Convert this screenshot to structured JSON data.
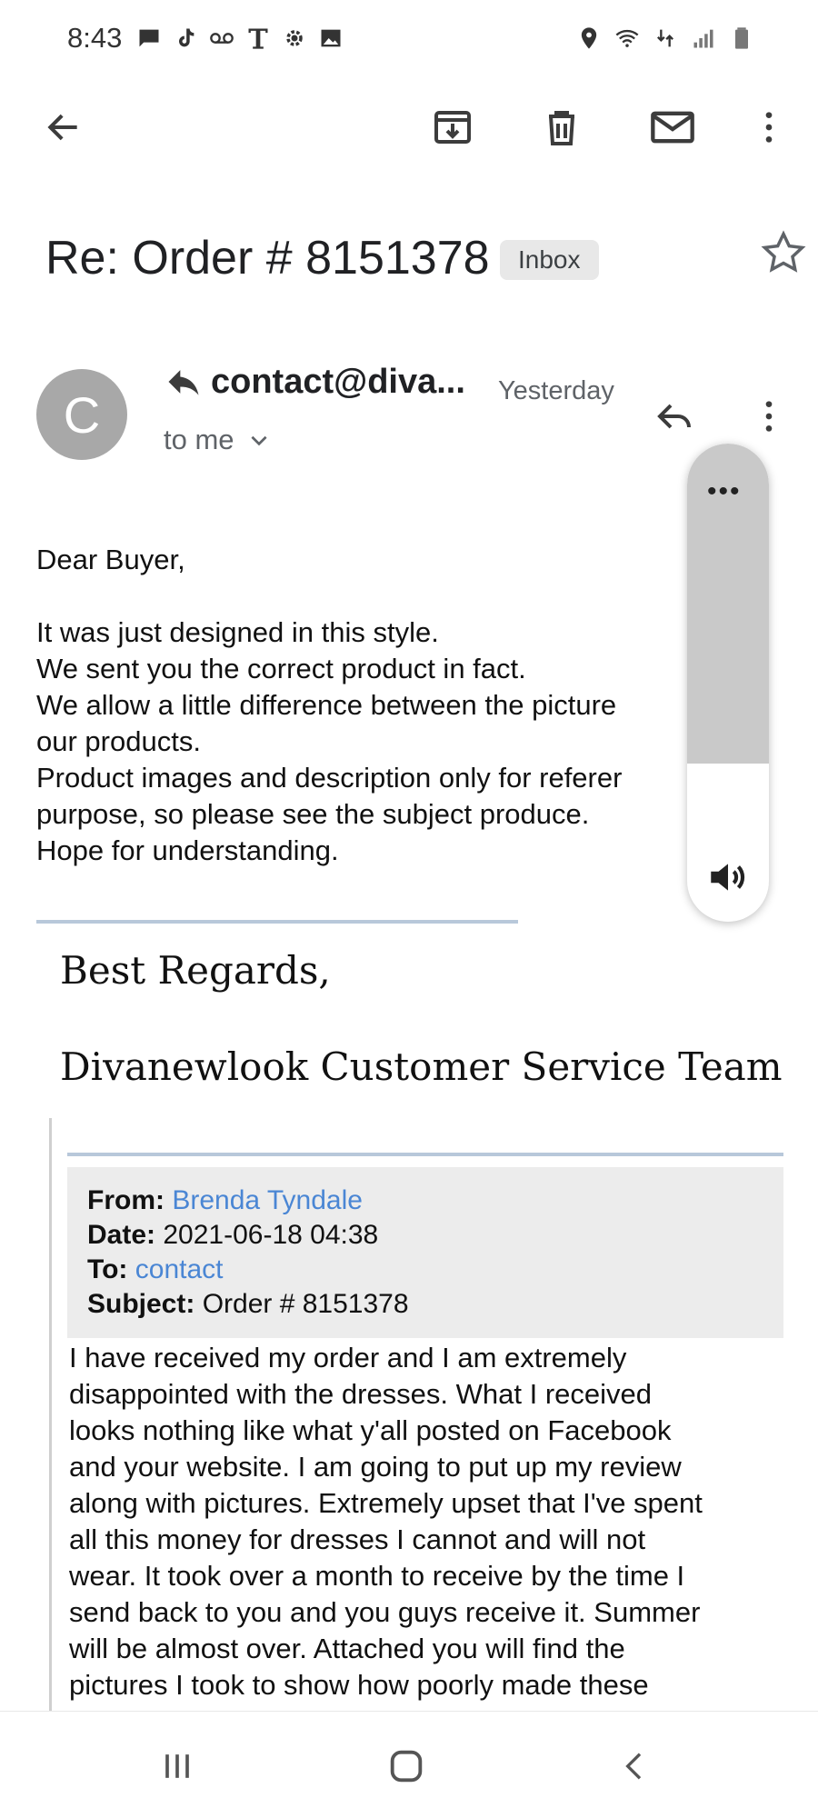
{
  "status_bar": {
    "time": "8:43",
    "left_icons": [
      "message-icon",
      "tiktok-icon",
      "voicemail-icon",
      "tmobile-icon",
      "settings-icon",
      "image-icon"
    ],
    "right_icons": [
      "location-icon",
      "wifi-icon",
      "data-4g-icon",
      "signal-icon",
      "battery-icon"
    ]
  },
  "toolbar": {
    "icons": [
      "back-arrow-icon",
      "archive-icon",
      "delete-icon",
      "mail-icon",
      "more-vert-icon"
    ]
  },
  "email": {
    "subject": "Re: Order # 8151378",
    "label": "Inbox",
    "avatar_letter": "C",
    "sender": "contact@diva...",
    "date": "Yesterday",
    "recipient": "to me",
    "body_lines": [
      "Dear Buyer,",
      "",
      "It was just designed in this style.",
      "We sent you the correct product in fact.",
      "We allow a little difference between the picture",
      "our products.",
      "Product images and description only for referer",
      "purpose, so please see the subject produce.",
      "Hope for understanding."
    ],
    "signature": {
      "line1": "Best Regards,",
      "line2": "Divanewlook Customer Service Team"
    },
    "quoted": {
      "from_label": "From:",
      "from": "Brenda Tyndale",
      "date_label": "Date:",
      "date": "2021-06-18 04:38",
      "to_label": "To:",
      "to": "contact",
      "subject_label": "Subject:",
      "subject": "Order # 8151378",
      "lines": [
        "I have received my order and I am extremely",
        "disappointed with the dresses.  What I received",
        "looks nothing like what y'all posted on Facebook",
        "and your website.  I am going to put up my review",
        "along with pictures.  Extremely upset that I've spent",
        "all this money for dresses I cannot and will not",
        "wear.  It took over a month to receive by the time I",
        "send back to you and you guys receive it.  Summer",
        "will be almost over.  Attached you will find the",
        "pictures I took to show how poorly made these"
      ]
    }
  },
  "volume": {
    "dots": "•••",
    "level": 0.67
  },
  "nav": {
    "icons": [
      "recents-icon",
      "home-icon",
      "nav-back-icon"
    ]
  }
}
